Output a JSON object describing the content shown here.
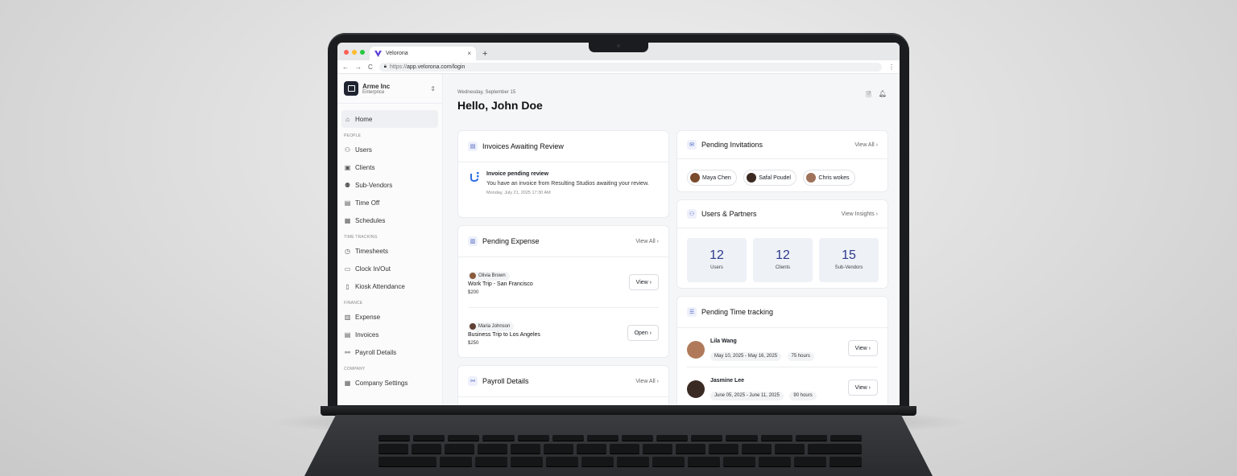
{
  "browser": {
    "tab_title": "Velorona",
    "tab_close": "×",
    "new_tab": "+",
    "url_proto": "https://",
    "url_rest": "app.velorona.com/login",
    "nav_back": "←",
    "nav_forward": "→",
    "nav_reload": "C",
    "menu": "⋮"
  },
  "workspace": {
    "name": "Arme Inc",
    "plan": "Enterprice"
  },
  "sidebar": {
    "home": "Home",
    "section_people": "PEOPLE",
    "people": [
      "Users",
      "Clients",
      "Sub-Vendors",
      "Time Off",
      "Schedules"
    ],
    "section_time": "TIME TRACKING",
    "time": [
      "Timesheets",
      "Clock In/Out",
      "Kiosk Attendance"
    ],
    "section_finance": "FINANCE",
    "finance": [
      "Expense",
      "Invoices",
      "Payroll Details"
    ],
    "section_company": "COMPANY",
    "company": [
      "Company Settings"
    ]
  },
  "header": {
    "date": "Wednesday, September 15",
    "greeting": "Hello, John Doe"
  },
  "invoices": {
    "title": "Invoices Awaiting Review",
    "item_title": "Invoice pending review",
    "item_body": "You have an invoice from Resulting Studios awaiting your review.",
    "item_time": "Monday, July 21, 2025  17:30 AM"
  },
  "expense": {
    "title": "Pending Expense",
    "view_all": "View All  ›",
    "items": [
      {
        "person": "Olivia Brown",
        "name": "Work Trip - San Francisco",
        "amount": "$200",
        "action": "View  ›"
      },
      {
        "person": "Maria Johnson",
        "name": "Business Trip to Los Angeles",
        "amount": "$250",
        "action": "Open  ›"
      }
    ]
  },
  "payroll": {
    "title": "Payroll Details",
    "view_all": "View All  ›"
  },
  "invitations": {
    "title": "Pending Invitations",
    "view_all": "View All  ›",
    "people": [
      "Maya Chen",
      "Safal Poudel",
      "Chris wokes"
    ]
  },
  "partners": {
    "title": "Users & Partners",
    "link": "View Insights  ›",
    "stats": [
      {
        "value": "12",
        "label": "Users"
      },
      {
        "value": "12",
        "label": "Clients"
      },
      {
        "value": "15",
        "label": "Sub-Vendors"
      }
    ]
  },
  "timetracking": {
    "title": "Pending Time tracking",
    "items": [
      {
        "name": "Lila Wang",
        "range": "May 10, 2025 - May 16, 2025",
        "hours": "75 hours",
        "action": "View  ›"
      },
      {
        "name": "Jasmine Lee",
        "range": "June 05, 2025 - June 11, 2025",
        "hours": "90 hours",
        "action": "View  ›"
      }
    ]
  },
  "colors": {
    "accent": "#2d3a8c",
    "brand": "#5b3fd6"
  }
}
